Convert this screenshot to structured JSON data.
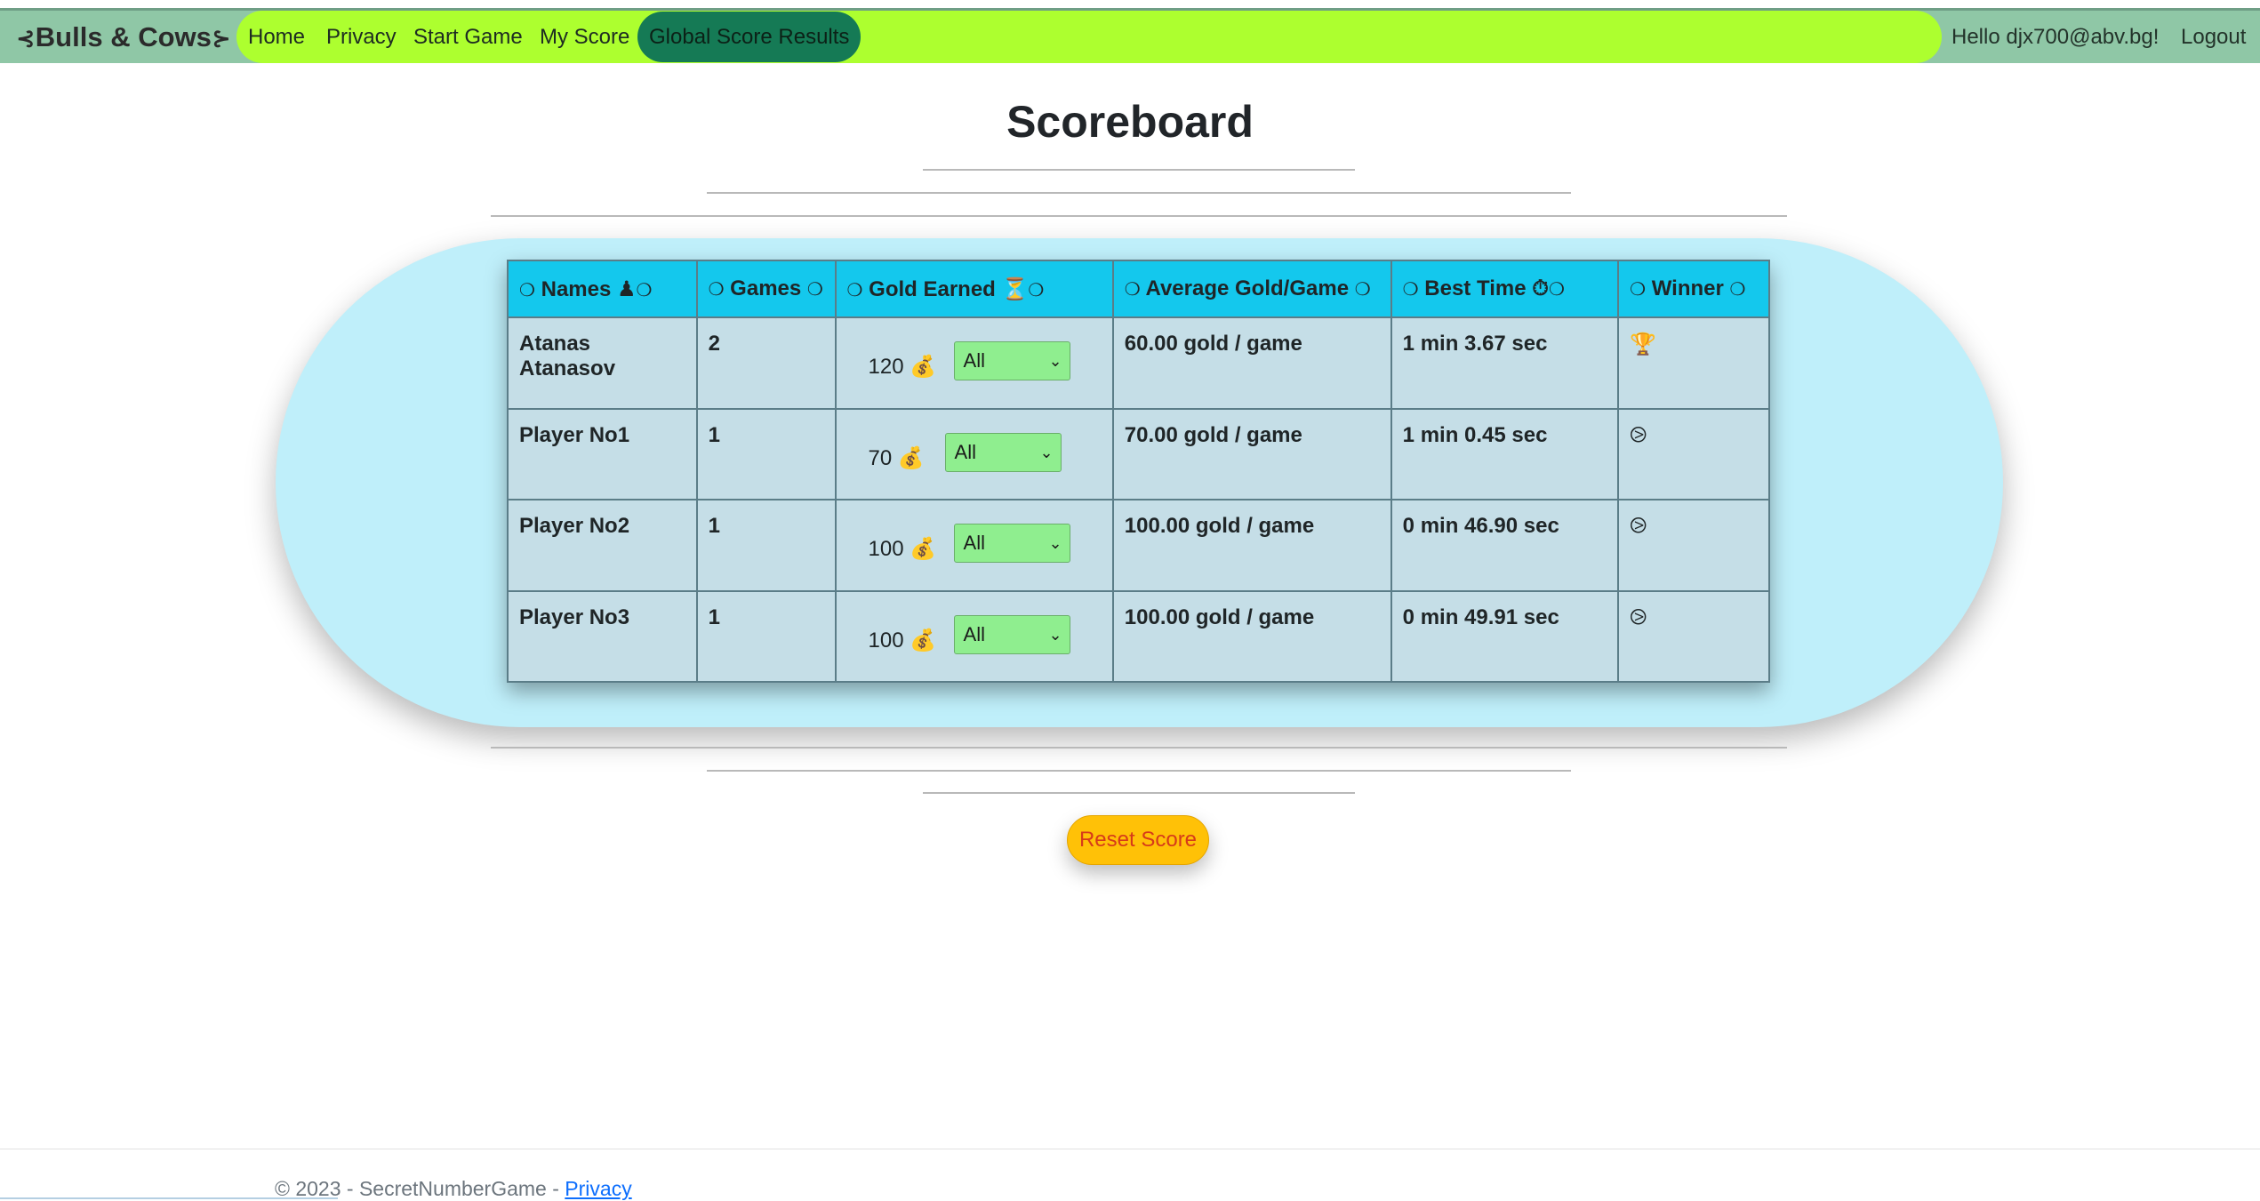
{
  "nav": {
    "brand": "Bulls & Cows",
    "brand_left_icon": "⊰",
    "brand_right_icon": "⊱",
    "links": [
      "Home",
      "Privacy",
      "Start Game",
      "My Score",
      "Global Score Results"
    ],
    "active_link": "Global Score Results",
    "greeting": "Hello djx700@abv.bg!",
    "logout": "Logout"
  },
  "page": {
    "title": "Scoreboard"
  },
  "table": {
    "headers": {
      "names": "Names",
      "names_icon": "♟",
      "games": "Games",
      "gold": "Gold Earned",
      "gold_icon": "⏳",
      "avg": "Average Gold/Game",
      "best": "Best Time",
      "best_icon": "⏱",
      "winner": "Winner",
      "ring": "❍"
    },
    "rows": [
      {
        "name": "Atanas Atanasov",
        "games": "2",
        "gold": "120",
        "filter": "All",
        "avg": "60.00 gold / game",
        "best": "1 min 3.67 sec",
        "winner": "🏆"
      },
      {
        "name": "Player No1",
        "games": "1",
        "gold": "70",
        "filter": "All",
        "avg": "70.00 gold / game",
        "best": "1 min 0.45 sec",
        "winner": "⧁"
      },
      {
        "name": "Player No2",
        "games": "1",
        "gold": "100",
        "filter": "All",
        "avg": "100.00 gold / game",
        "best": "0 min 46.90 sec",
        "winner": "⧁"
      },
      {
        "name": "Player No3",
        "games": "1",
        "gold": "100",
        "filter": "All",
        "avg": "100.00 gold / game",
        "best": "0 min 49.91 sec",
        "winner": "⧁"
      }
    ],
    "gold_icon": "💰"
  },
  "reset_button": "Reset Score",
  "footer": {
    "text": "© 2023 - SecretNumberGame - ",
    "link": "Privacy"
  },
  "colors": {
    "navbar": "#8fc7a6",
    "nav_pill": "#adff2f",
    "active_link": "#157a55",
    "panel": "#bfeffa",
    "table_header": "#14c8ed",
    "table_body": "#c5dee7",
    "select": "#8fee8f",
    "reset": "#ffc107"
  }
}
